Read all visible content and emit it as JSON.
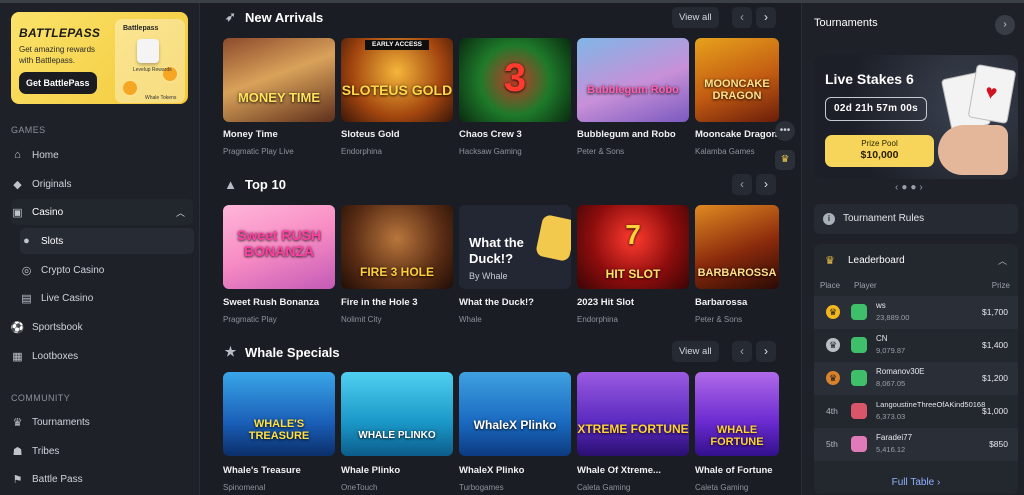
{
  "battlepass": {
    "logo": "BATTLEPASS",
    "subtitle": "Get amazing rewards with Battlepass.",
    "button": "Get BattlePass",
    "card_title": "Battlepass",
    "card_line1": "Levelup Rewards",
    "card_line2": "Whale Tokens"
  },
  "sidebar": {
    "games_heading": "GAMES",
    "community_heading": "COMMUNITY",
    "items": [
      {
        "label": "Home"
      },
      {
        "label": "Originals"
      },
      {
        "label": "Casino"
      },
      {
        "label": "Slots"
      },
      {
        "label": "Crypto Casino"
      },
      {
        "label": "Live Casino"
      },
      {
        "label": "Sportsbook"
      },
      {
        "label": "Lootboxes"
      },
      {
        "label": "Tournaments"
      },
      {
        "label": "Tribes"
      },
      {
        "label": "Battle Pass"
      }
    ]
  },
  "sections": [
    {
      "title": "New Arrivals",
      "view_all": "View all",
      "games": [
        {
          "name": "Money Time",
          "provider": "Pragmatic Play Live",
          "art": "MONEY TIME"
        },
        {
          "name": "Sloteus Gold",
          "provider": "Endorphina",
          "art": "SLOTEUS GOLD",
          "badge": "EARLY ACCESS"
        },
        {
          "name": "Chaos Crew 3",
          "provider": "Hacksaw Gaming",
          "art": "3"
        },
        {
          "name": "Bubblegum and Robo",
          "provider": "Peter & Sons",
          "art": "Bubblegum Robo"
        },
        {
          "name": "Mooncake Dragon",
          "provider": "Kalamba Games",
          "art": "MOONCAKE DRAGON"
        }
      ]
    },
    {
      "title": "Top 10",
      "games": [
        {
          "name": "Sweet Rush Bonanza",
          "provider": "Pragmatic Play",
          "art": "Sweet RUSH BONANZA"
        },
        {
          "name": "Fire in the Hole 3",
          "provider": "Nolimit City",
          "art": "FIRE 3 HOLE"
        },
        {
          "name": "What the Duck!?",
          "provider": "Whale",
          "art": "What the Duck!?",
          "art_sub": "By Whale"
        },
        {
          "name": "2023 Hit Slot",
          "provider": "Endorphina",
          "art": "HIT SLOT"
        },
        {
          "name": "Barbarossa",
          "provider": "Peter & Sons",
          "art": "BARBAROSSA"
        }
      ]
    },
    {
      "title": "Whale Specials",
      "view_all": "View all",
      "games": [
        {
          "name": "Whale's Treasure",
          "provider": "Spinomenal",
          "art": "WHALE'S TREASURE"
        },
        {
          "name": "Whale Plinko",
          "provider": "OneTouch",
          "art": "WHALE PLINKO"
        },
        {
          "name": "WhaleX Plinko",
          "provider": "Turbogames",
          "art": "WhaleX Plinko"
        },
        {
          "name": "Whale Of Xtreme...",
          "provider": "Caleta Gaming",
          "art": "XTREME FORTUNE"
        },
        {
          "name": "Whale of Fortune",
          "provider": "Caleta Gaming",
          "art": "WHALE FORTUNE"
        }
      ]
    }
  ],
  "tournaments": {
    "title": "Tournaments",
    "promo_title": "Live Stakes 6",
    "countdown": "02d  21h  57m  00s",
    "prize_label": "Prize Pool",
    "prize_value": "$10,000",
    "rules": "Tournament Rules",
    "leaderboard": {
      "title": "Leaderboard",
      "col_place": "Place",
      "col_player": "Player",
      "col_prize": "Prize",
      "rows": [
        {
          "rank": "1",
          "player": "ws",
          "points": "23,889.00",
          "prize": "$1,700"
        },
        {
          "rank": "2",
          "player": "CN",
          "points": "9,079.87",
          "prize": "$1,400"
        },
        {
          "rank": "3",
          "player": "Romanov30E",
          "points": "8,067.05",
          "prize": "$1,200"
        },
        {
          "rank": "4th",
          "player": "LangoustineThreeOfAKind50168",
          "points": "6,373.03",
          "prize": "$1,000"
        },
        {
          "rank": "5th",
          "player": "Faradei77",
          "points": "5,416.12",
          "prize": "$850"
        }
      ],
      "full_table": "Full Table"
    }
  },
  "colors": {
    "accent_yellow": "#f7d55b",
    "background": "#1a1d24",
    "link": "#8fb2ff"
  }
}
